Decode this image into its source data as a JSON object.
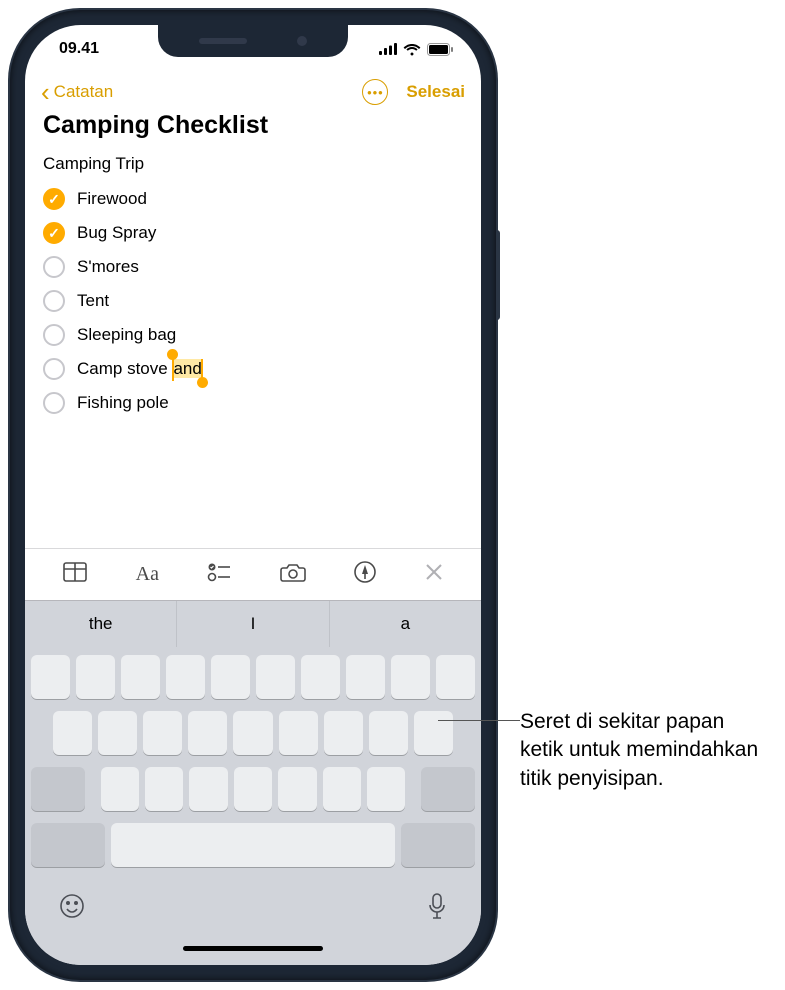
{
  "status": {
    "time": "09.41"
  },
  "nav": {
    "back_label": "Catatan",
    "done_label": "Selesai"
  },
  "note": {
    "title": "Camping Checklist",
    "subheading": "Camping Trip",
    "items": [
      {
        "label": "Firewood",
        "checked": true
      },
      {
        "label": "Bug Spray",
        "checked": true
      },
      {
        "label": "S'mores",
        "checked": false
      },
      {
        "label": "Tent",
        "checked": false
      },
      {
        "label": "Sleeping bag",
        "checked": false
      },
      {
        "label_pre": "Camp stove ",
        "label_sel": "and",
        "checked": false,
        "selection": true
      },
      {
        "label": "Fishing pole",
        "checked": false
      }
    ]
  },
  "suggestions": [
    "the",
    "I",
    "a"
  ],
  "callout": "Seret di sekitar papan ketik untuk memindahkan titik penyisipan."
}
